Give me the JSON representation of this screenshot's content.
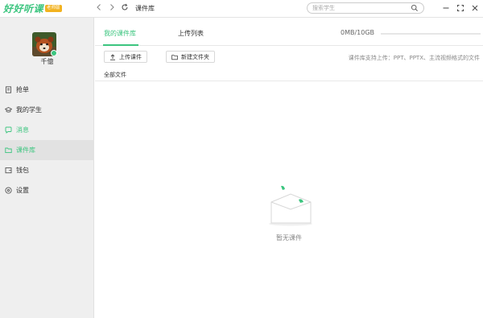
{
  "app": {
    "logo_text": "好好听课",
    "logo_badge": "老师版",
    "page_title": "课件库"
  },
  "search": {
    "placeholder": "搜索学生"
  },
  "user": {
    "name": "千億"
  },
  "sidebar": {
    "items": [
      {
        "label": "抢单",
        "icon": "document-icon"
      },
      {
        "label": "我的学生",
        "icon": "graduation-cap-icon"
      },
      {
        "label": "消息",
        "icon": "chat-icon"
      },
      {
        "label": "课件库",
        "icon": "folder-icon"
      },
      {
        "label": "钱包",
        "icon": "wallet-icon"
      },
      {
        "label": "设置",
        "icon": "settings-icon"
      }
    ],
    "active_index": 3
  },
  "tabs": [
    {
      "label": "我的课件库",
      "active": true
    },
    {
      "label": "上传列表",
      "active": false
    }
  ],
  "storage": {
    "used_text": "0MB/10GB",
    "used_fraction": 0.0
  },
  "toolbar": {
    "upload_label": "上传课件",
    "new_folder_label": "新建文件夹",
    "hint": "课件库支持上传：PPT、PPTX、主流视频格式的文件"
  },
  "breadcrumb": {
    "label": "全部文件"
  },
  "empty": {
    "text": "暂无课件"
  },
  "colors": {
    "accent": "#3cc57f",
    "badge": "#f2b21f"
  }
}
